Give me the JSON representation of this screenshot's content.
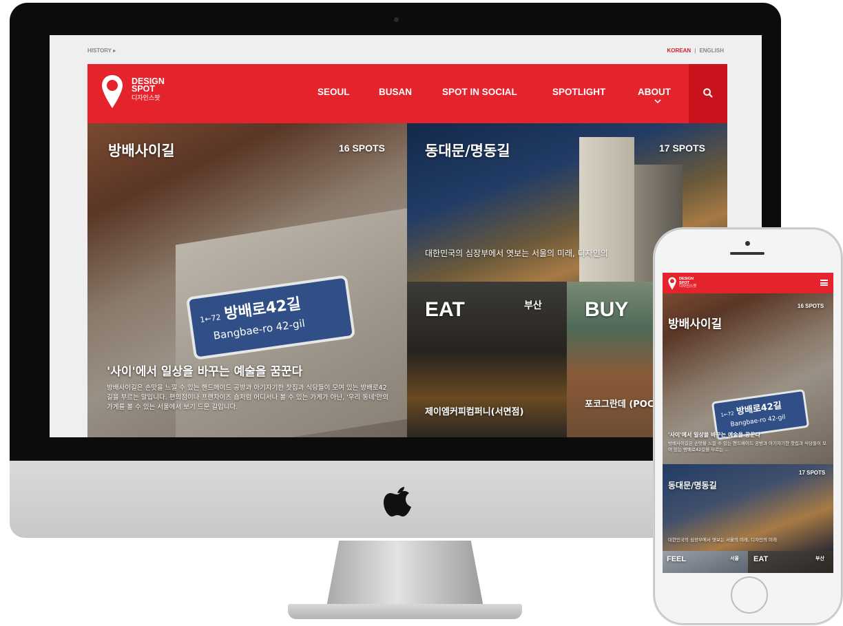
{
  "topbar": {
    "history": "HISTORY ▸",
    "lang_korean": "KOREAN",
    "lang_sep": "|",
    "lang_english": "ENGLISH"
  },
  "logo": {
    "line1": "DESIGN",
    "line2": "SPOT",
    "korean": "디자인스팟"
  },
  "nav": {
    "items": [
      {
        "label": "SEOUL"
      },
      {
        "label": "BUSAN"
      },
      {
        "label": "SPOT IN SOCIAL"
      },
      {
        "label": "SPOTLIGHT"
      },
      {
        "label": "ABOUT"
      }
    ]
  },
  "tiles": {
    "bangbae": {
      "title": "방배사이길",
      "count": "16 SPOTS",
      "sign_small": "1←72",
      "sign_ko": "방배로42길",
      "sign_en": "Bangbae-ro 42-gil",
      "headline": "'사이'에서 일상을 바꾸는 예술을 꿈꾼다",
      "desc": "방배사이길은 손맛을 느낄 수 있는 핸드메이드 공방과 아기자기한 찻집과 식당들이 모여 있는 방배로42길을 부르는 말입니다. 편의점이나 프랜차이즈 숍처럼 어디서나 볼 수 있는 가게가 아닌, '우리 동네'만의 가게를 볼 수 있는 서울에서 보기 드문 길입니다."
    },
    "dongdaemun": {
      "title": "동대문/명동길",
      "count": "17 SPOTS",
      "desc": "대한민국의 심장부에서 엿보는 서울의 미래, 디자인의"
    },
    "eat": {
      "title": "EAT",
      "region": "부산",
      "spot": "제이엠커피컴퍼니(서면점)"
    },
    "buy": {
      "title": "BUY",
      "spot": "포코그란데 (POCO GRANDE)"
    }
  },
  "phone": {
    "logo_line1": "DESIGN",
    "logo_line2": "SPOT",
    "logo_ko": "디자인스팟",
    "tile1_count": "16 SPOTS",
    "tile1_title": "방배사이길",
    "tile1_headline": "'사이'에서 일상을 바꾸는 예술을 꿈꾼다",
    "tile1_desc": "방배사이길은 손맛을 느낄 수 있는 핸드메이드 공방과 아기자기한 찻집과 식당들이 모여 있는 방배로42길을 부르는 ...",
    "tile2_count": "17 SPOTS",
    "tile2_title": "동대문/명동길",
    "tile2_desc": "대한민국의 심장부에서 엿보는 서울의 미래, 디자인의 미래",
    "tile3_title": "FEEL",
    "tile3_region": "서울",
    "tile4_title": "EAT",
    "tile4_region": "부산"
  },
  "colors": {
    "brand_red": "#e5232c",
    "search_red": "#c9121b",
    "lang_active": "#c9262c"
  }
}
